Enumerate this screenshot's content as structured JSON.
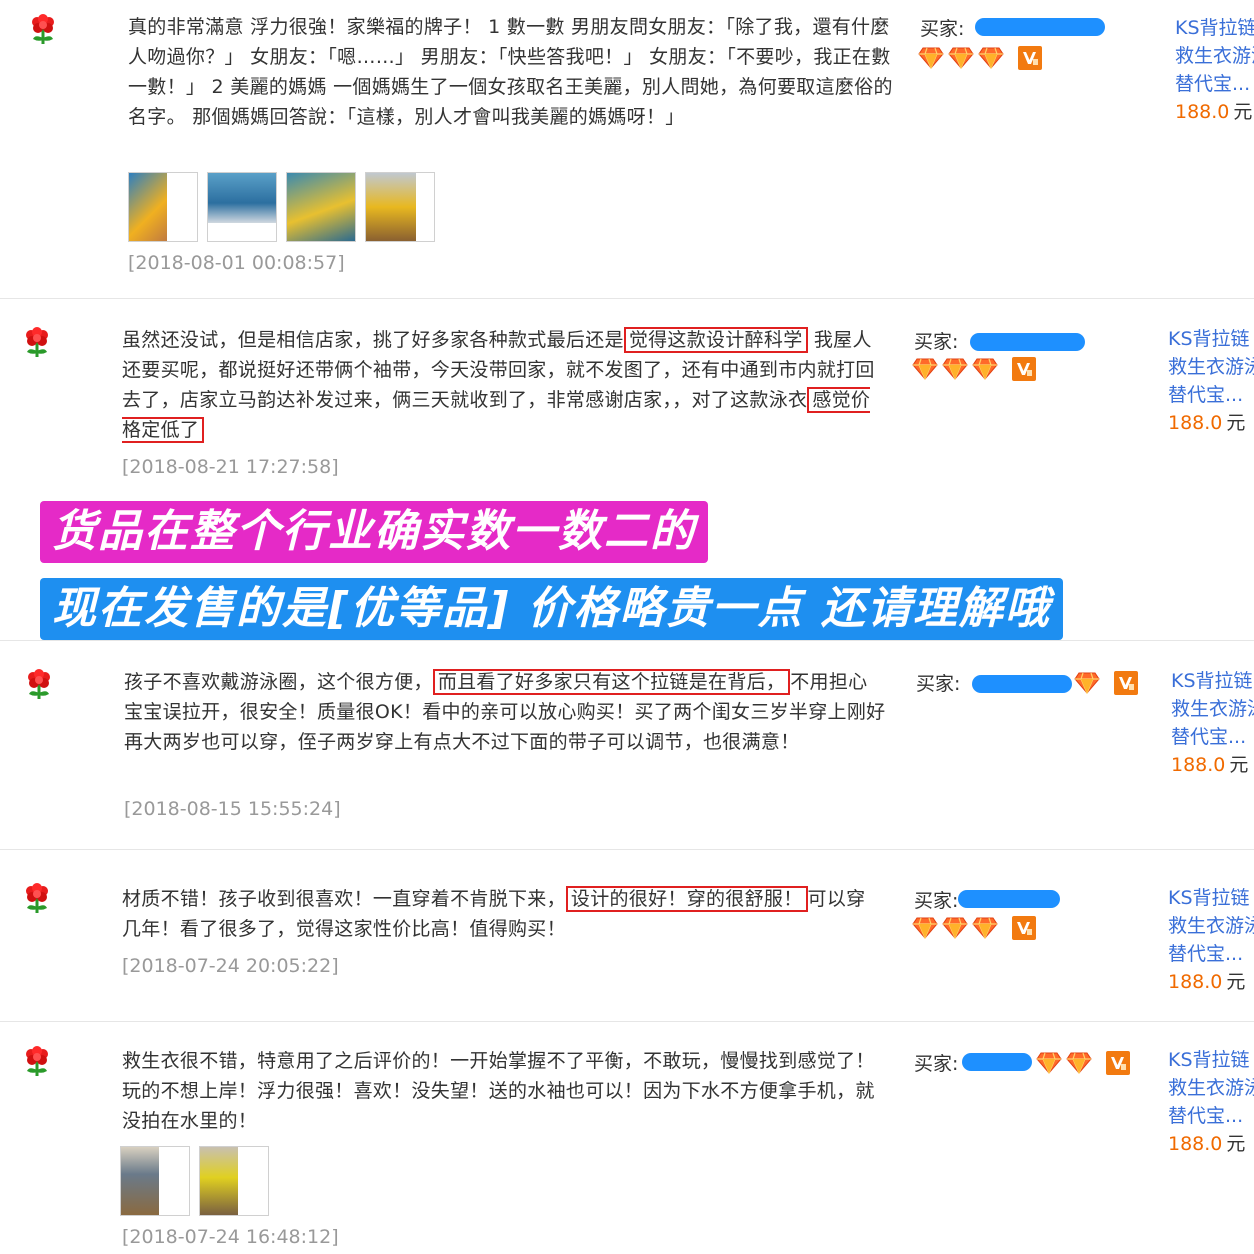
{
  "labels": {
    "buyer": "买家:"
  },
  "colors": {
    "banner_pink": "#e52ac7",
    "banner_blue": "#1e8ff0",
    "highlight": "#e02020",
    "price": "#f06a00",
    "link": "#3a6fd8"
  },
  "product": {
    "line1": "KS背拉链",
    "line2": "救生衣游泳",
    "line3": "替代宝...",
    "price": "188.0",
    "currency": "元"
  },
  "banners": {
    "line1": "货品在整个行业确实数一数二的",
    "line2": "现在发售的是[优等品] 价格略贵一点  还请理解哦"
  },
  "reviews": [
    {
      "text": "真的非常滿意 浮力很強！家樂福的牌子！ 1 數一數 男朋友問女朋友：「除了我，還有什麼人吻過你？」 女朋友：「嗯……」 男朋友：「快些答我吧！」 女朋友：「不要吵，我正在數一數！」 2 美麗的媽媽 一個媽媽生了一個女孩取名王美麗，別人問她，為何要取這麼俗的名字。 那個媽媽回答說：「這樣，別人才會叫我美麗的媽媽呀！」",
      "date": "[2018-08-01 00:08:57]",
      "photo_count": 4
    },
    {
      "text_before": "虽然还没试，但是相信店家，挑了好多家各种款式最后还是",
      "highlight_1": "觉得这款设计醉科学",
      "text_middle": " 我屋人还要买呢，都说挺好还带俩个袖带，今天没带回家，就不发图了，还有中通到市内就打回去了，店家立马韵达补发过来，俩三天就收到了，非常感谢店家，，对了这款泳衣",
      "highlight_2": "感觉价格定低了",
      "date": "[2018-08-21 17:27:58]"
    },
    {
      "text_before": "孩子不喜欢戴游泳圈，这个很方便，",
      "highlight": "而且看了好多家只有这个拉链是在背后，",
      "text_after": "不用担心宝宝误拉开，很安全！质量很OK！看中的亲可以放心购买！买了两个闺女三岁半穿上刚好再大两岁也可以穿，侄子两岁穿上有点大不过下面的带子可以调节，也很满意！",
      "date": "[2018-08-15 15:55:24]"
    },
    {
      "text_before": "材质不错！孩子收到很喜欢！一直穿着不肯脱下来，",
      "highlight": "设计的很好！穿的很舒服！",
      "text_after": "可以穿几年！看了很多了，觉得这家性价比高！值得购买！",
      "date": "[2018-07-24 20:05:22]"
    },
    {
      "text": "救生衣很不错，特意用了之后评价的！一开始掌握不了平衡，不敢玩，慢慢找到感觉了！玩的不想上岸！浮力很强！喜欢！没失望！送的水袖也可以！因为下水不方便拿手机，就没拍在水里的！",
      "date": "[2018-07-24 16:48:12]",
      "photo_count": 2
    }
  ]
}
